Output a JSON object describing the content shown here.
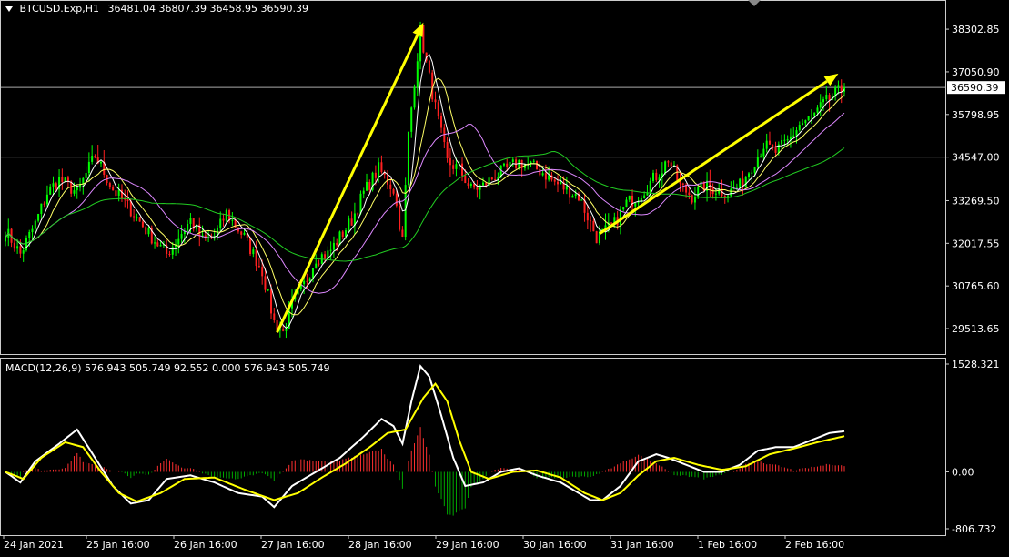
{
  "header": {
    "symbol_text": "BTCUSD.Exp,H1",
    "ohlc_text": "36481.04 36807.39 36458.95 36590.39",
    "dropdown_icon": "triangle-down-icon"
  },
  "colors": {
    "background": "#000000",
    "bull_candle": "#00ff00",
    "bear_candle": "#ff2020",
    "ma_fast": "#ffffff",
    "ma_mid": "#ffff66",
    "ma_slow": "#dd88ff",
    "ma_long": "#22cc22",
    "arrow": "#ffff00",
    "macd_line": "#ffffff",
    "signal_line": "#ffff00",
    "hist_pos": "#ff3030",
    "hist_neg": "#00aa00",
    "grid": "#aaaaaa",
    "current_price_bg": "#ffffff"
  },
  "chart_data": [
    {
      "type": "candlestick",
      "title": "BTCUSD.Exp,H1",
      "current_price_label": "36590.39",
      "ylim": [
        28900,
        39000
      ],
      "y_ticks": [
        "38302.85",
        "37050.90",
        "35798.95",
        "34547.00",
        "33269.50",
        "32017.55",
        "30765.60",
        "29513.65"
      ],
      "x_ticks": [
        "24 Jan 2021",
        "25 Jan 16:00",
        "26 Jan 16:00",
        "27 Jan 16:00",
        "28 Jan 16:00",
        "29 Jan 16:00",
        "30 Jan 16:00",
        "31 Jan 16:00",
        "1 Feb 16:00",
        "2 Feb 16:00"
      ],
      "horizontal_levels": [
        36590.39,
        34547.0
      ],
      "price_path": [
        [
          0,
          32400
        ],
        [
          5,
          31700
        ],
        [
          10,
          32600
        ],
        [
          14,
          33500
        ],
        [
          18,
          33900
        ],
        [
          24,
          33500
        ],
        [
          30,
          34600
        ],
        [
          36,
          33600
        ],
        [
          42,
          33000
        ],
        [
          48,
          32300
        ],
        [
          54,
          31700
        ],
        [
          58,
          32200
        ],
        [
          62,
          32700
        ],
        [
          66,
          32100
        ],
        [
          70,
          32200
        ],
        [
          74,
          32900
        ],
        [
          80,
          32200
        ],
        [
          86,
          31200
        ],
        [
          90,
          29700
        ],
        [
          93,
          29400
        ],
        [
          96,
          30200
        ],
        [
          100,
          30800
        ],
        [
          104,
          31600
        ],
        [
          108,
          31700
        ],
        [
          112,
          32200
        ],
        [
          116,
          32700
        ],
        [
          120,
          33500
        ],
        [
          125,
          34200
        ],
        [
          130,
          33600
        ],
        [
          133,
          32100
        ],
        [
          135,
          35200
        ],
        [
          137,
          36800
        ],
        [
          139,
          38250
        ],
        [
          141,
          37300
        ],
        [
          144,
          36000
        ],
        [
          148,
          34400
        ],
        [
          152,
          34200
        ],
        [
          156,
          33600
        ],
        [
          160,
          33700
        ],
        [
          164,
          34000
        ],
        [
          168,
          34200
        ],
        [
          172,
          34400
        ],
        [
          176,
          34300
        ],
        [
          180,
          34100
        ],
        [
          184,
          33800
        ],
        [
          188,
          33600
        ],
        [
          192,
          33400
        ],
        [
          196,
          32600
        ],
        [
          198,
          32200
        ],
        [
          200,
          32300
        ],
        [
          204,
          32600
        ],
        [
          208,
          33200
        ],
        [
          212,
          33400
        ],
        [
          216,
          33800
        ],
        [
          220,
          34200
        ],
        [
          222,
          34500
        ],
        [
          224,
          34100
        ],
        [
          226,
          33700
        ],
        [
          230,
          33400
        ],
        [
          234,
          33700
        ],
        [
          238,
          33600
        ],
        [
          242,
          33500
        ],
        [
          246,
          33700
        ],
        [
          250,
          34300
        ],
        [
          254,
          34900
        ],
        [
          258,
          34700
        ],
        [
          262,
          35000
        ],
        [
          266,
          35500
        ],
        [
          270,
          35700
        ],
        [
          274,
          36100
        ],
        [
          278,
          36400
        ],
        [
          281,
          36590
        ]
      ],
      "series": [
        {
          "name": "",
          "period_role": "fast",
          "smoothing": 5
        },
        {
          "name": "",
          "period_role": "mid",
          "smoothing": 10
        },
        {
          "name": "",
          "period_role": "slow",
          "smoothing": 22
        },
        {
          "name": "",
          "period_role": "long",
          "smoothing": 50
        }
      ],
      "annotations": [
        {
          "type": "arrow",
          "from": [
            91,
            29400
          ],
          "to": [
            140,
            38500
          ]
        },
        {
          "type": "arrow",
          "from": [
            199,
            32300
          ],
          "to": [
            279,
            37000
          ]
        }
      ]
    },
    {
      "type": "macd",
      "label": "MACD(12,26,9) 576.943 505.749 92.552 0.000 576.943 505.749",
      "ylim": [
        -806.732,
        1528.321
      ],
      "y_ticks": [
        "1528.321",
        "0.00",
        "-806.732"
      ],
      "macd_path": [
        [
          0,
          0
        ],
        [
          5,
          -150
        ],
        [
          10,
          150
        ],
        [
          18,
          400
        ],
        [
          24,
          600
        ],
        [
          30,
          200
        ],
        [
          36,
          -200
        ],
        [
          42,
          -450
        ],
        [
          48,
          -400
        ],
        [
          54,
          -100
        ],
        [
          62,
          -50
        ],
        [
          70,
          -150
        ],
        [
          78,
          -300
        ],
        [
          86,
          -350
        ],
        [
          90,
          -500
        ],
        [
          96,
          -200
        ],
        [
          104,
          0
        ],
        [
          112,
          200
        ],
        [
          120,
          500
        ],
        [
          126,
          750
        ],
        [
          130,
          650
        ],
        [
          133,
          400
        ],
        [
          136,
          1000
        ],
        [
          139,
          1500
        ],
        [
          142,
          1350
        ],
        [
          146,
          800
        ],
        [
          150,
          200
        ],
        [
          154,
          -200
        ],
        [
          160,
          -150
        ],
        [
          166,
          0
        ],
        [
          172,
          50
        ],
        [
          178,
          -50
        ],
        [
          186,
          -150
        ],
        [
          192,
          -300
        ],
        [
          196,
          -400
        ],
        [
          200,
          -400
        ],
        [
          206,
          -200
        ],
        [
          212,
          150
        ],
        [
          218,
          250
        ],
        [
          222,
          200
        ],
        [
          228,
          100
        ],
        [
          234,
          0
        ],
        [
          240,
          0
        ],
        [
          246,
          100
        ],
        [
          252,
          300
        ],
        [
          258,
          350
        ],
        [
          264,
          350
        ],
        [
          270,
          450
        ],
        [
          276,
          550
        ],
        [
          281,
          577
        ]
      ],
      "signal_path": [
        [
          0,
          0
        ],
        [
          6,
          -100
        ],
        [
          12,
          200
        ],
        [
          20,
          420
        ],
        [
          26,
          350
        ],
        [
          32,
          0
        ],
        [
          38,
          -300
        ],
        [
          44,
          -420
        ],
        [
          52,
          -300
        ],
        [
          60,
          -100
        ],
        [
          70,
          -80
        ],
        [
          80,
          -250
        ],
        [
          90,
          -400
        ],
        [
          98,
          -300
        ],
        [
          106,
          -80
        ],
        [
          114,
          120
        ],
        [
          122,
          350
        ],
        [
          128,
          550
        ],
        [
          134,
          600
        ],
        [
          140,
          1050
        ],
        [
          144,
          1250
        ],
        [
          148,
          1000
        ],
        [
          152,
          450
        ],
        [
          156,
          0
        ],
        [
          162,
          -100
        ],
        [
          170,
          0
        ],
        [
          178,
          20
        ],
        [
          186,
          -80
        ],
        [
          194,
          -300
        ],
        [
          200,
          -400
        ],
        [
          206,
          -300
        ],
        [
          212,
          -50
        ],
        [
          218,
          150
        ],
        [
          224,
          200
        ],
        [
          232,
          100
        ],
        [
          240,
          30
        ],
        [
          248,
          80
        ],
        [
          256,
          250
        ],
        [
          264,
          330
        ],
        [
          272,
          420
        ],
        [
          281,
          506
        ]
      ],
      "histogram_bars": 281
    }
  ]
}
